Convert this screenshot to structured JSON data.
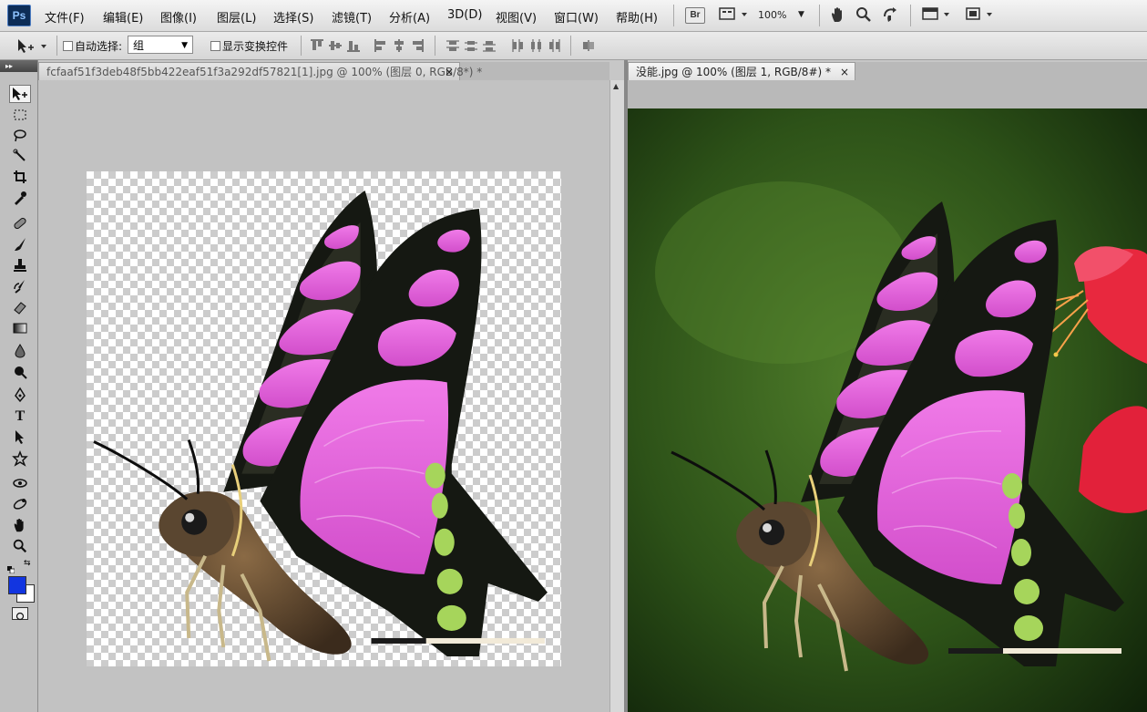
{
  "app": {
    "logo": "Ps"
  },
  "menu": {
    "items": [
      "文件(F)",
      "编辑(E)",
      "图像(I)",
      "图层(L)",
      "选择(S)",
      "滤镜(T)",
      "分析(A)",
      "3D(D)",
      "视图(V)",
      "窗口(W)",
      "帮助(H)"
    ],
    "bridge_label": "Br",
    "zoom_value": "100%",
    "icons": [
      "hand-icon",
      "zoom-icon",
      "rotate-view-icon",
      "arrange-documents-icon",
      "screen-mode-icon"
    ]
  },
  "options": {
    "tool_icon": "move-tool-icon",
    "auto_select_label": "自动选择:",
    "auto_select_checked": false,
    "auto_select_value": "组",
    "show_transform_label": "显示变换控件",
    "show_transform_checked": false
  },
  "tools": [
    "move-tool",
    "marquee-tool",
    "lasso-tool",
    "quick-selection-tool",
    "crop-tool",
    "eyedropper-tool",
    "healing-brush-tool",
    "brush-tool",
    "clone-stamp-tool",
    "history-brush-tool",
    "eraser-tool",
    "gradient-tool",
    "blur-tool",
    "dodge-tool",
    "pen-tool",
    "type-tool",
    "path-selection-tool",
    "shape-tool",
    "3d-rotate-tool",
    "3d-orbit-tool",
    "hand-tool",
    "zoom-tool"
  ],
  "colors": {
    "foreground": "#1235e0",
    "background": "#ffffff"
  },
  "documents": [
    {
      "tab_title": "fcfaaf51f3deb48f5bb422eaf51f3a292df57821[1].jpg @ 100% (图层 0, RGB/8*) *",
      "background": "transparent",
      "active": false
    },
    {
      "tab_title": "没能.jpg @ 100% (图层 1, RGB/8#) *",
      "background": "blurred-green-with-red-flower",
      "active": true
    }
  ],
  "tab_close_glyph": "×"
}
